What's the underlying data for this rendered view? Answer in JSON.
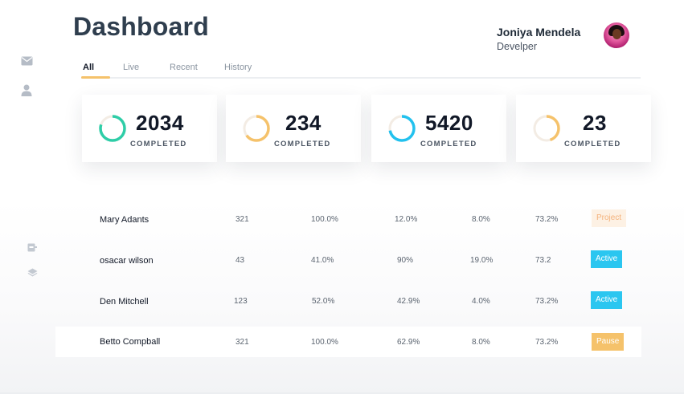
{
  "header": {
    "title": "Dashboard",
    "user": {
      "name": "Joniya Mendela",
      "role": "Develper"
    }
  },
  "sidebar": {
    "icons": [
      "mail-icon",
      "user-icon",
      "inbox-icon",
      "layers-icon"
    ]
  },
  "tabs": [
    {
      "label": "All",
      "active": true
    },
    {
      "label": "Live",
      "active": false
    },
    {
      "label": "Recent",
      "active": false
    },
    {
      "label": "History",
      "active": false
    }
  ],
  "stats": [
    {
      "value": "2034",
      "label": "COMPLETED",
      "color": "#2ecda7",
      "progress": 0.8
    },
    {
      "value": "234",
      "label": "COMPLETED",
      "color": "#f5c26b",
      "progress": 0.65
    },
    {
      "value": "5420",
      "label": "COMPLETED",
      "color": "#22c1ee",
      "progress": 0.72
    },
    {
      "value": "23",
      "label": "COMPLETED",
      "color": "#f5c26b",
      "progress": 0.45
    }
  ],
  "table": {
    "rows": [
      {
        "name": "Mary Adants",
        "c1": "321",
        "c2": "100.0%",
        "c3": "12.0%",
        "c4": "8.0%",
        "c5": "73.2%",
        "status": "Project",
        "status_bg": "#fdf1e4",
        "status_fg": "#f4b27c"
      },
      {
        "name": "osacar wilson",
        "c1": "43",
        "c2": "41.0%",
        "c3": "90%",
        "c4": "19.0%",
        "c5": "73.2",
        "status": "Active",
        "status_bg": "#2bc6f0",
        "status_fg": "#ffffff"
      },
      {
        "name": "Den Mitchell",
        "c1": "123",
        "c2": "52.0%",
        "c3": "42.9%",
        "c4": "4.0%",
        "c5": "73.2%",
        "status": "Active",
        "status_bg": "#2bc6f0",
        "status_fg": "#ffffff"
      },
      {
        "name": "Betto Compball",
        "c1": "321",
        "c2": "100.0%",
        "c3": "62.9%",
        "c4": "8.0%",
        "c5": "73.2%",
        "status": "Pause",
        "status_bg": "#f5c26b",
        "status_fg": "#ffffff"
      }
    ]
  }
}
